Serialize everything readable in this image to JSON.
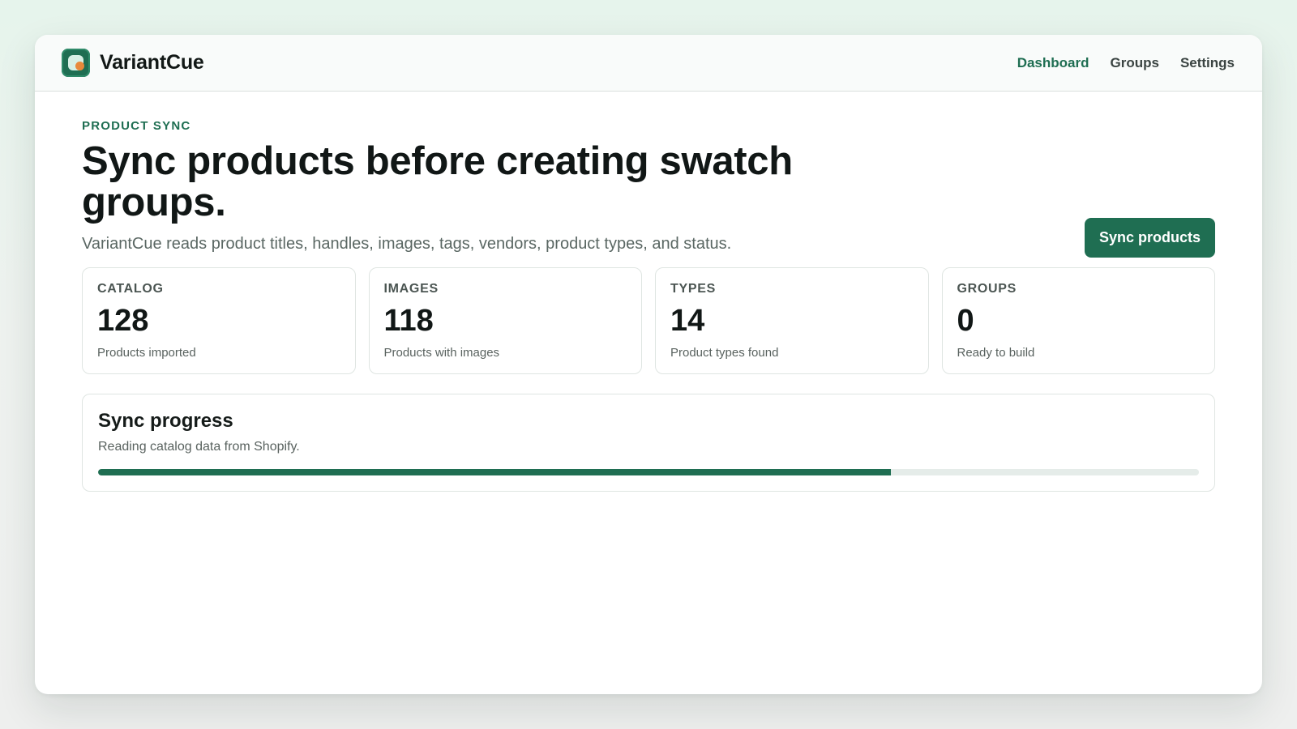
{
  "app": {
    "name": "VariantCue",
    "logo_icon": "variantcue-logo-icon"
  },
  "nav": {
    "items": [
      {
        "label": "Dashboard",
        "active": true
      },
      {
        "label": "Groups",
        "active": false
      },
      {
        "label": "Settings",
        "active": false
      }
    ]
  },
  "header": {
    "eyebrow": "PRODUCT SYNC",
    "title": "Sync products before creating swatch groups.",
    "subtitle": "VariantCue reads product titles, handles, images, tags, vendors, product types, and status.",
    "action_label": "Sync products"
  },
  "stats": [
    {
      "label": "CATALOG",
      "value": "128",
      "description": "Products imported"
    },
    {
      "label": "IMAGES",
      "value": "118",
      "description": "Products with images"
    },
    {
      "label": "TYPES",
      "value": "14",
      "description": "Product types found"
    },
    {
      "label": "GROUPS",
      "value": "0",
      "description": "Ready to build"
    }
  ],
  "progress": {
    "title": "Sync progress",
    "text": "Reading catalog data from Shopify.",
    "percent": 72
  },
  "colors": {
    "accent": "#1f6e52",
    "logo_dot": "#e8893a",
    "track": "#e5ece9"
  }
}
